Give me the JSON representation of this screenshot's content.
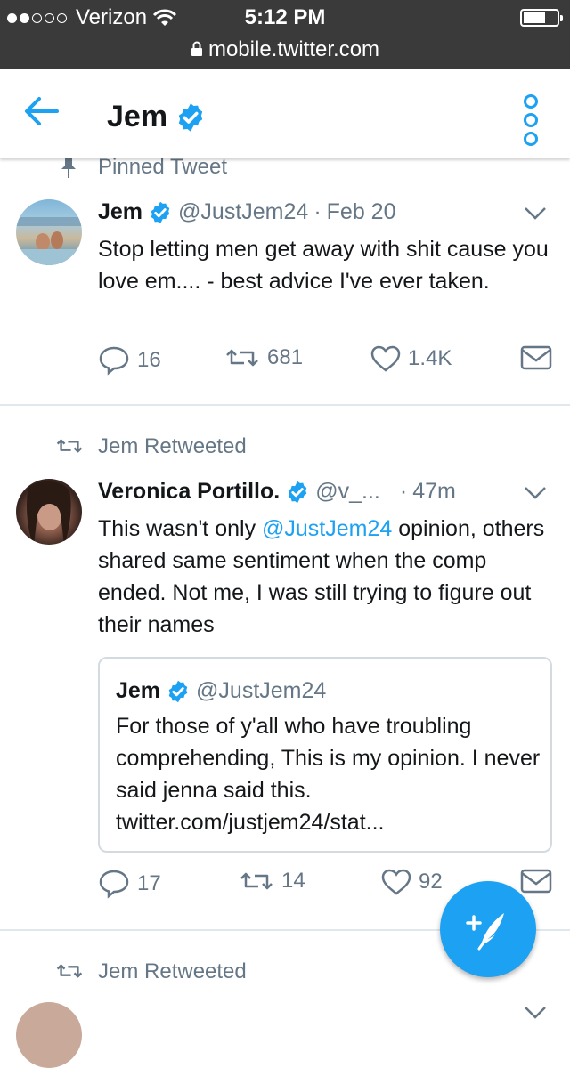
{
  "status_bar": {
    "carrier": "Verizon",
    "time": "5:12 PM",
    "url": "mobile.twitter.com"
  },
  "header": {
    "title": "Jem"
  },
  "pinned": {
    "label": "Pinned Tweet",
    "name": "Jem",
    "handle": "@JustJem24",
    "separator": "·",
    "date": "Feb 20",
    "text": "Stop letting men get away with shit cause you love em.... - best advice I've ever taken.",
    "replies": "16",
    "retweets": "681",
    "likes": "1.4K"
  },
  "retweet1": {
    "label": "Jem Retweeted",
    "name": "Veronica Portillo.",
    "handle": "@v_...",
    "separator": "·",
    "date": "47m",
    "text_before": "This wasn't only ",
    "mention": "@JustJem24",
    "text_after": " opinion, others shared same sentiment when the comp ended. Not me, I was still trying to figure out their names",
    "quote": {
      "name": "Jem",
      "handle": "@JustJem24",
      "text": "For those of y'all who have troubling comprehending, This is my opinion. I never said jenna said this. twitter.com/justjem24/stat..."
    },
    "replies": "17",
    "retweets": "14",
    "likes": "92"
  },
  "retweet2": {
    "label": "Jem Retweeted"
  },
  "colors": {
    "accent": "#1da1f2",
    "text": "#14171a",
    "secondary": "#657786"
  }
}
